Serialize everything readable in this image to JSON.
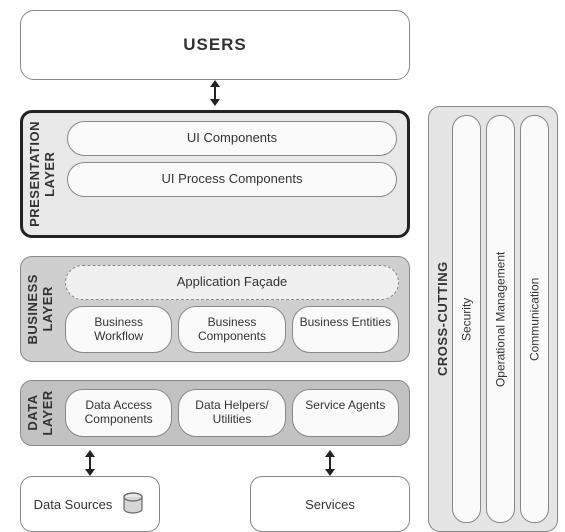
{
  "users": {
    "title": "USERS"
  },
  "presentation": {
    "label": "PRESENTATION\nLAYER",
    "ui_components": "UI Components",
    "ui_process": "UI Process Components"
  },
  "business": {
    "label": "BUSINESS\nLAYER",
    "facade": "Application Façade",
    "workflow": "Business Workflow",
    "components": "Business Components",
    "entities": "Business Entities"
  },
  "data": {
    "label": "DATA\nLAYER",
    "access": "Data Access Components",
    "helpers": "Data Helpers/ Utilities",
    "agents": "Service Agents"
  },
  "bottom": {
    "datasources": "Data Sources",
    "services": "Services"
  },
  "crosscut": {
    "label": "CROSS-CUTTING",
    "security": "Security",
    "opmgmt": "Operational Management",
    "comm": "Communication"
  }
}
